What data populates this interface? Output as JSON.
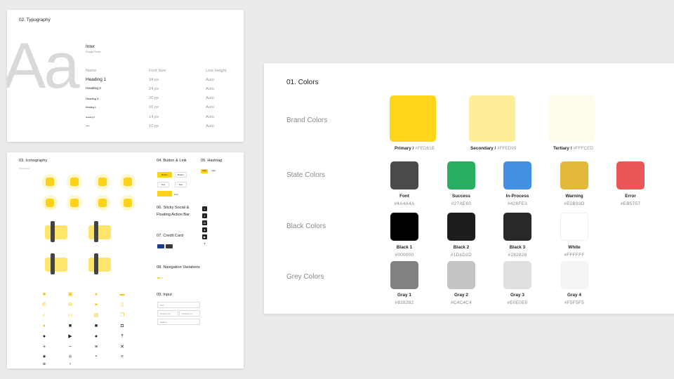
{
  "typography": {
    "section_title": "02. Typography",
    "sample": "Aa",
    "font_name": "Inter",
    "font_source": "Google Fonts",
    "headers": {
      "name": "Name",
      "size": "Font Size",
      "line_height": "Line Height"
    },
    "rows": [
      {
        "name": "Heading 1",
        "size": "34 px",
        "lh": "Auto"
      },
      {
        "name": "Heading 2",
        "size": "24 px",
        "lh": "Auto"
      },
      {
        "name": "Heading 3",
        "size": "20 px",
        "lh": "Auto"
      },
      {
        "name": "Heading 4",
        "size": "16 px",
        "lh": "Auto"
      },
      {
        "name": "Heading 5",
        "size": "14 px",
        "lh": "Auto"
      },
      {
        "name": "Label",
        "size": "10 px",
        "lh": "Auto"
      }
    ]
  },
  "iconography": {
    "section_title": "03. Iconography",
    "sub_label": "Illustrations",
    "buttons_title": "04. Button & Link",
    "hashtag_title": "05. Hashtag",
    "button_label": "Button",
    "text_label": "Text",
    "link_label": "Link",
    "label_label": "Label",
    "sticky_title_1": "06. Sticky Social &",
    "sticky_title_2": "Floating Action Bar",
    "credit_title": "07. Credit Card",
    "nav_title": "08. Navigation Variations",
    "input_title": "09. Input",
    "input_1": "Text",
    "input_2": "Choose an",
    "input_2b": "Choose an",
    "input_3": "Search"
  },
  "colors": {
    "title": "01. Colors",
    "rows": {
      "brand": "Brand Colors",
      "state": "State Colors",
      "black": "Black Colors",
      "grey": "Grey Colors"
    },
    "brand": [
      {
        "name": "Primary",
        "hex": "#FED61B",
        "color": "#FED61B"
      },
      {
        "name": "Secondary",
        "hex": "#FFED99",
        "color": "#FFED99"
      },
      {
        "name": "Tertiary",
        "hex": "#FFFCED",
        "color": "#FFFCED"
      }
    ],
    "state": [
      {
        "name": "Font",
        "hex": "#4A4A4A",
        "color": "#4A4A4A"
      },
      {
        "name": "Success",
        "hex": "#27AE60",
        "color": "#27AE60"
      },
      {
        "name": "In-Process",
        "hex": "#428FE3",
        "color": "#428FE3"
      },
      {
        "name": "Warning",
        "hex": "#E2B93D",
        "color": "#E2B93D"
      },
      {
        "name": "Error",
        "hex": "#EB5757",
        "color": "#EB5757"
      }
    ],
    "black": [
      {
        "name": "Black 1",
        "hex": "#000000",
        "color": "#000000"
      },
      {
        "name": "Black 2",
        "hex": "#1D1D1D",
        "color": "#1D1D1D"
      },
      {
        "name": "Black 3",
        "hex": "#282828",
        "color": "#282828"
      },
      {
        "name": "White",
        "hex": "#FFFFFF",
        "color": "#FFFFFF"
      }
    ],
    "grey": [
      {
        "name": "Gray 1",
        "hex": "#828282",
        "color": "#828282"
      },
      {
        "name": "Gray 2",
        "hex": "#C4C4C4",
        "color": "#C4C4C4"
      },
      {
        "name": "Gray 3",
        "hex": "#E0E0E0",
        "color": "#E0E0E0"
      },
      {
        "name": "Gray 4",
        "hex": "#F5F5F5",
        "color": "#F5F5F5"
      }
    ]
  }
}
